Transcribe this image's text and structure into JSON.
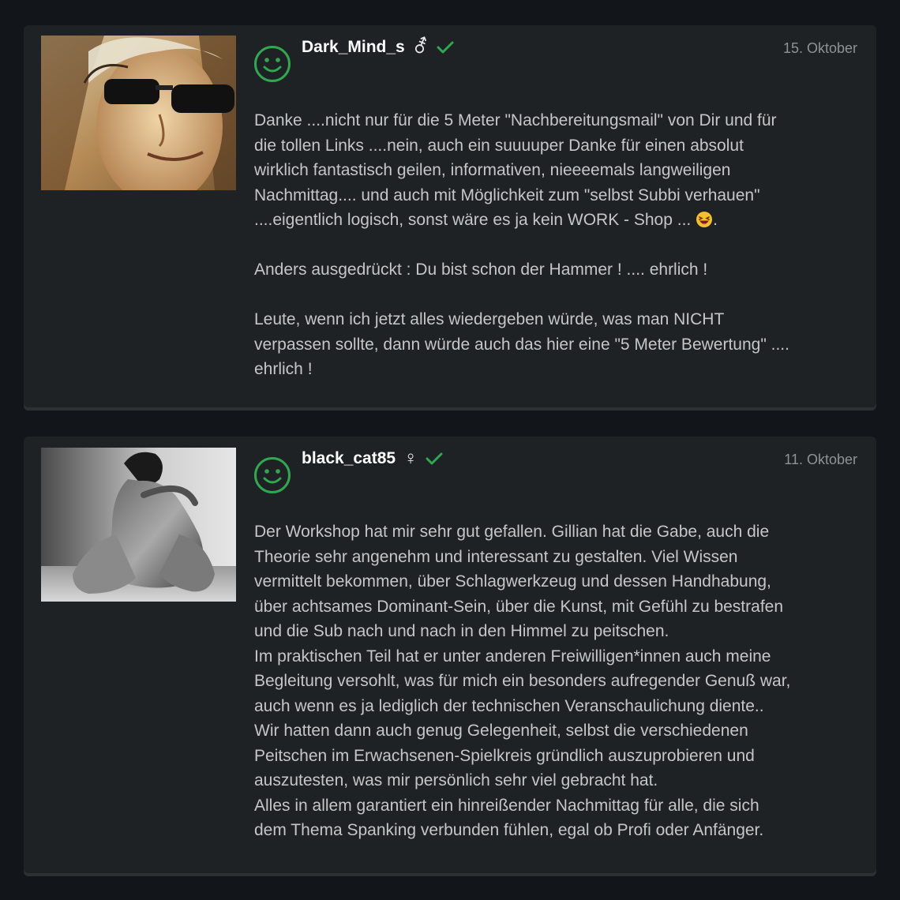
{
  "reviews": [
    {
      "username": "Dark_Mind_s",
      "gender_icon": "⚦",
      "gender_icon_name": "intersex-symbol-icon",
      "verified_icon": "checkmark-icon",
      "date": "15. Oktober",
      "avatar_icon": "smiley-icon",
      "photo": "profile-photo-man-with-sunglasses",
      "paragraphs": [
        {
          "lines": [
            "Danke ....nicht nur für die 5 Meter \"Nachbereitungsmail\" von Dir und für",
            "die tollen Links ....nein, auch ein suuuuper Danke für einen absolut",
            "wirklich fantastisch geilen, informativen, nieeeemals langweiligen",
            "Nachmittag.... und auch mit Möglichkeit zum \"selbst Subbi verhauen\"",
            "....eigentlich logisch, sonst wäre es ja kein WORK - Shop ... "
          ],
          "trailing_emoji": "laughing-face-emoji",
          "trailing_text": "."
        },
        {
          "lines": [
            "Anders ausgedrückt : Du bist schon der Hammer ! .... ehrlich !"
          ]
        },
        {
          "lines": [
            "Leute, wenn ich jetzt alles wiedergeben würde, was man NICHT",
            "verpassen sollte, dann würde auch das hier eine \"5 Meter Bewertung\" ....",
            "ehrlich !"
          ]
        }
      ]
    },
    {
      "username": "black_cat85",
      "gender_icon": "♀",
      "gender_icon_name": "female-symbol-icon",
      "verified_icon": "checkmark-icon",
      "date": "11. Oktober",
      "avatar_icon": "smiley-icon",
      "photo": "profile-photo-black-and-white-figure",
      "paragraphs": [
        {
          "lines": [
            "Der Workshop hat mir sehr gut gefallen. Gillian hat die Gabe, auch die",
            "Theorie sehr angenehm und interessant zu gestalten. Viel Wissen",
            "vermittelt bekommen, über Schlagwerkzeug und dessen Handhabung,",
            "über achtsames Dominant-Sein, über die Kunst, mit Gefühl zu bestrafen",
            "und die Sub nach und nach in den Himmel zu peitschen.",
            "Im praktischen Teil hat er unter anderen Freiwilligen*innen auch meine",
            "Begleitung versohlt, was für mich ein besonders aufregender Genuß war,",
            "auch wenn es ja lediglich der technischen Veranschaulichung diente..",
            "Wir hatten dann auch genug Gelegenheit, selbst die verschiedenen",
            "Peitschen im Erwachsenen-Spielkreis gründlich auszuprobieren und",
            "auszutesten, was mir persönlich sehr viel gebracht hat.",
            "Alles in allem garantiert ein hinreißender Nachmittag für alle, die sich",
            "dem Thema Spanking verbunden fühlen, egal ob Profi oder Anfänger."
          ]
        }
      ]
    }
  ],
  "colors": {
    "background": "#12161a",
    "card": "#1f2224",
    "accent_green": "#2fa84f",
    "username": "#ffffff",
    "date": "#8d9296",
    "text": "#c6c6c6"
  }
}
